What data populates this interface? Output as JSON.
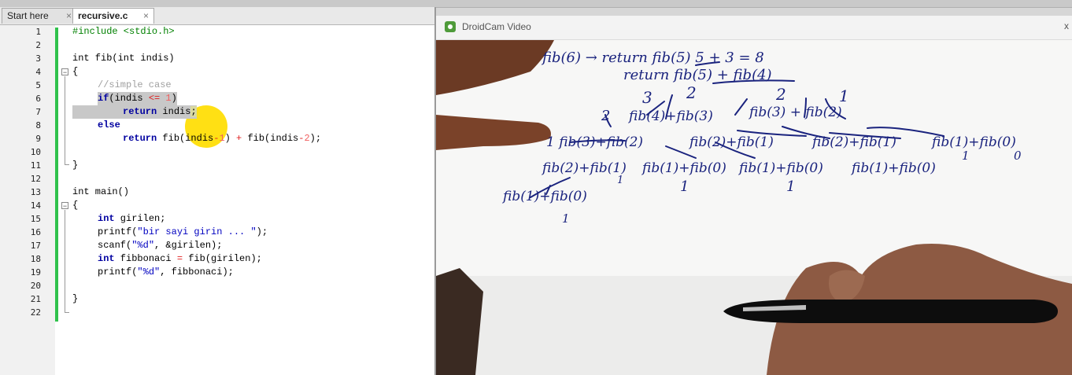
{
  "tabs": [
    {
      "label": "Start here",
      "close": "×"
    },
    {
      "label": "recursive.c",
      "close": "×"
    }
  ],
  "editor": {
    "lines": [
      {
        "n": "1"
      },
      {
        "n": "2"
      },
      {
        "n": "3"
      },
      {
        "n": "4"
      },
      {
        "n": "5"
      },
      {
        "n": "6"
      },
      {
        "n": "7"
      },
      {
        "n": "8"
      },
      {
        "n": "9"
      },
      {
        "n": "10"
      },
      {
        "n": "11"
      },
      {
        "n": "12"
      },
      {
        "n": "13"
      },
      {
        "n": "14"
      },
      {
        "n": "15"
      },
      {
        "n": "16"
      },
      {
        "n": "17"
      },
      {
        "n": "18"
      },
      {
        "n": "19"
      },
      {
        "n": "20"
      },
      {
        "n": "21"
      },
      {
        "n": "22"
      }
    ],
    "code": {
      "l1": "#include <stdio.h>",
      "l3": "int fib(int indis)",
      "l4": "{",
      "l5": "//simple case",
      "l6_kw": "if",
      "l6_a": "(indis ",
      "l6_op": "<=",
      "l6_num": " 1",
      "l6_b": ")",
      "l7_kw": "return",
      "l7_a": " indis",
      "l7_b": ";",
      "l8_kw": "else",
      "l9_kw": "return",
      "l9_a": " fib(indis",
      "l9_op1": "-",
      "l9_n1": "1",
      "l9_b": ") ",
      "l9_op2": "+",
      "l9_c": " fib(indis",
      "l9_op3": "-",
      "l9_n2": "2",
      "l9_d": ");",
      "l11": "}",
      "l13": "int main()",
      "l14": "{",
      "l15_kw": "int",
      "l15_a": " girilen;",
      "l16_a": "printf(",
      "l16_s": "\"bir sayi girin ... \"",
      "l16_b": ");",
      "l17_a": "scanf(",
      "l17_s": "\"%d\"",
      "l17_b": ", &girilen);",
      "l18_kw": "int",
      "l18_a": " fibbonaci ",
      "l18_op": "=",
      "l18_b": " fib(girilen);",
      "l19_a": "printf(",
      "l19_s": "\"%d\"",
      "l19_b": ", fibbonaci);",
      "l21": "}"
    }
  },
  "video_window": {
    "title": "DroidCam Video",
    "close": "x"
  },
  "colors": {
    "change_bar": "#2fc24b",
    "keyword": "#0000a0",
    "preprocessor": "#008000",
    "cursor_highlight": "#ffdd00",
    "ink": "#1a237e"
  }
}
